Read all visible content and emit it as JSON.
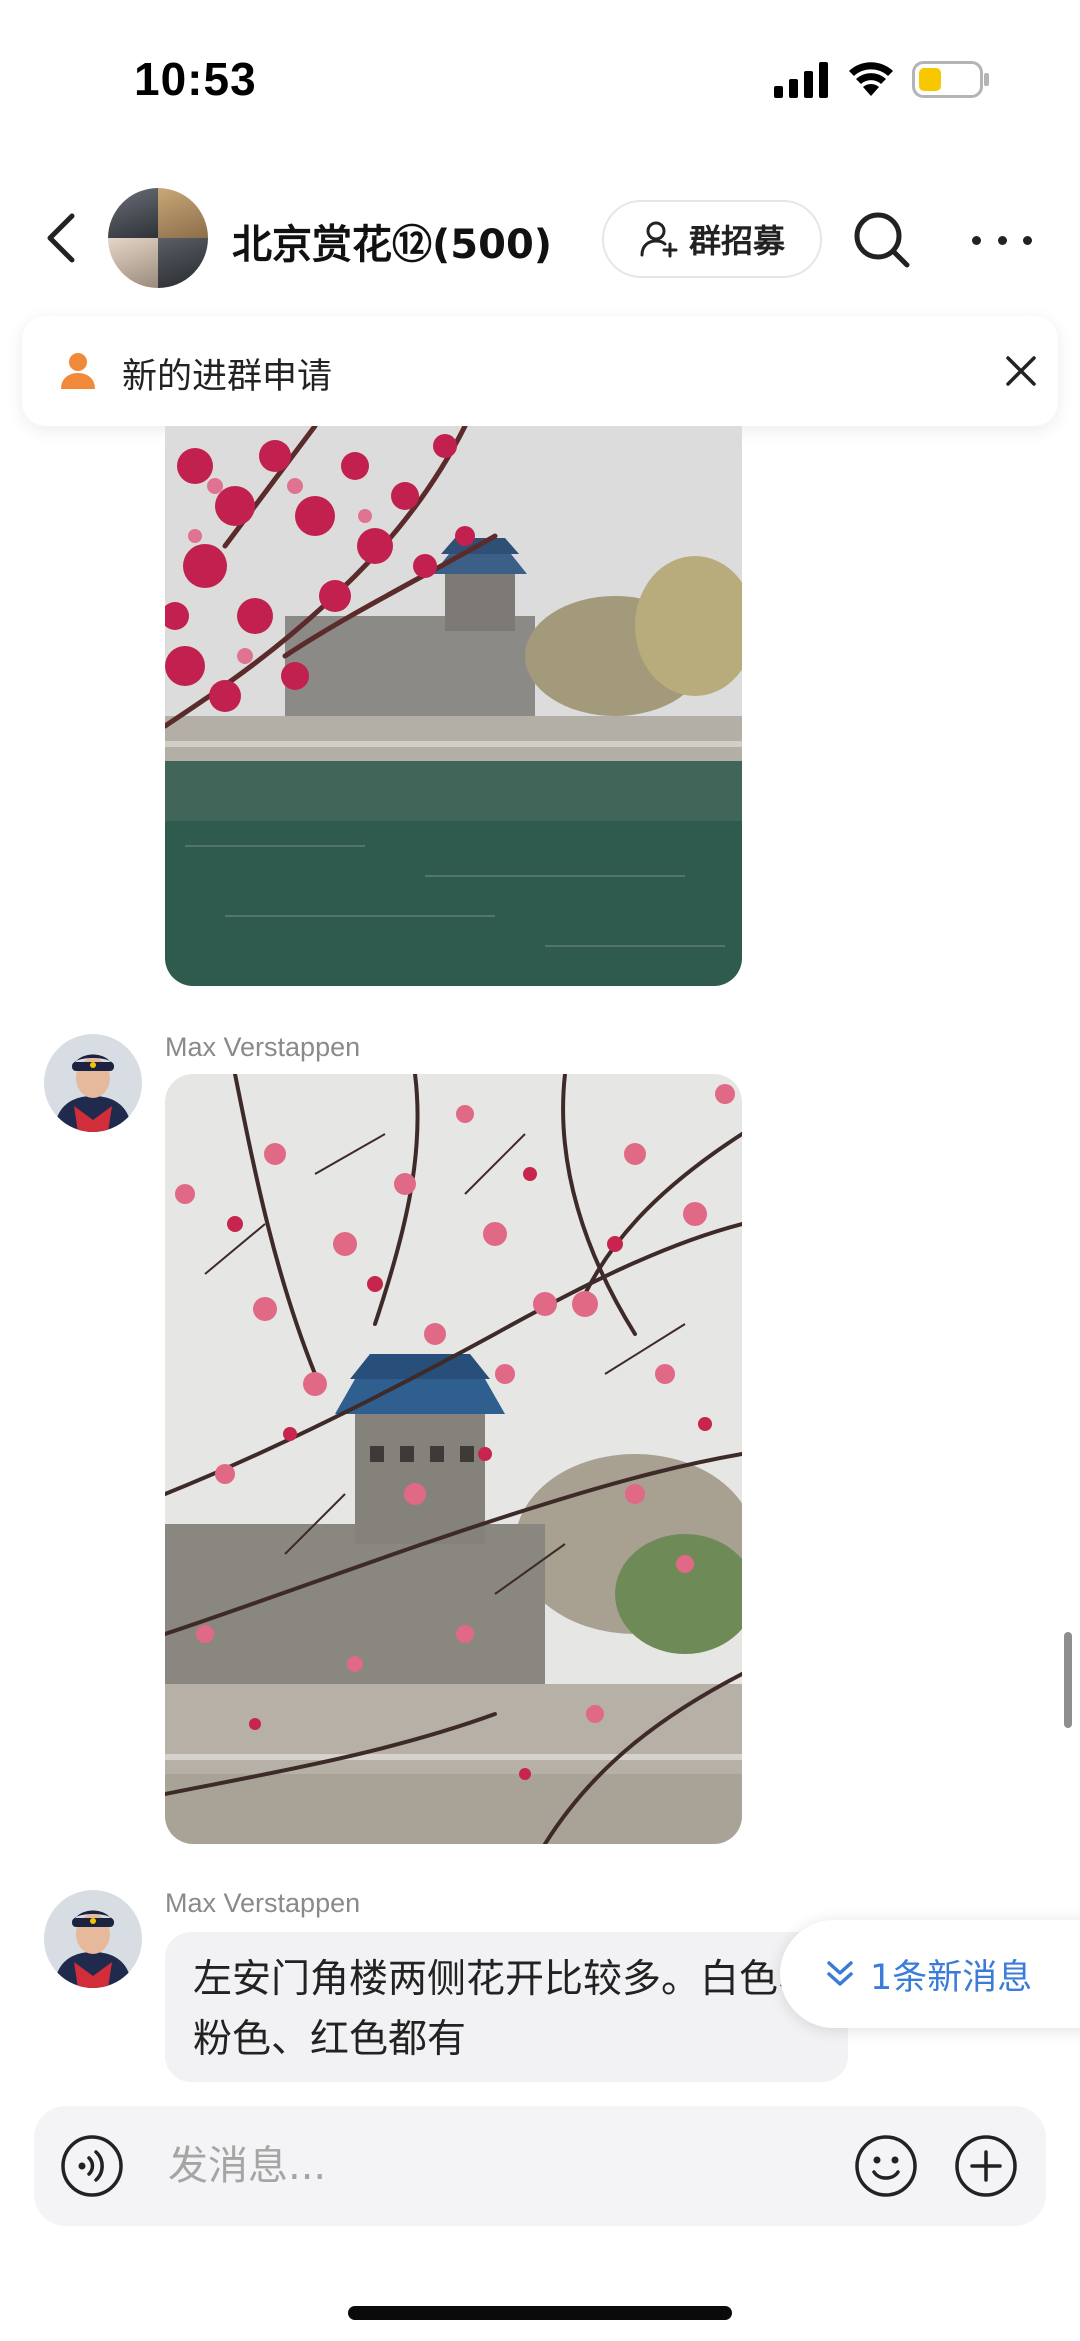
{
  "status_bar": {
    "time": "10:53",
    "battery_color": "#f7c800"
  },
  "header": {
    "title": "北京赏花⑫(500)",
    "recruit_label": "群招募",
    "icons": [
      "back-icon",
      "add-person-icon",
      "search-icon",
      "more-icon"
    ]
  },
  "notice": {
    "text": "新的进群申请",
    "icon": "person-icon",
    "accent": "#f08a3a"
  },
  "messages": [
    {
      "type": "image",
      "subject": "cherry blossoms over moat with corner tower"
    },
    {
      "type": "image",
      "sender": "Max Verstappen",
      "subject": "plum blossoms in front of corner tower"
    },
    {
      "type": "text",
      "sender": "Max Verstappen",
      "text": "左安门角楼两侧花开比较多。白色、粉色、红色都有"
    }
  ],
  "new_message_badge": {
    "label": "1条新消息",
    "color": "#3b7cd8"
  },
  "input": {
    "placeholder": "发消息..."
  }
}
